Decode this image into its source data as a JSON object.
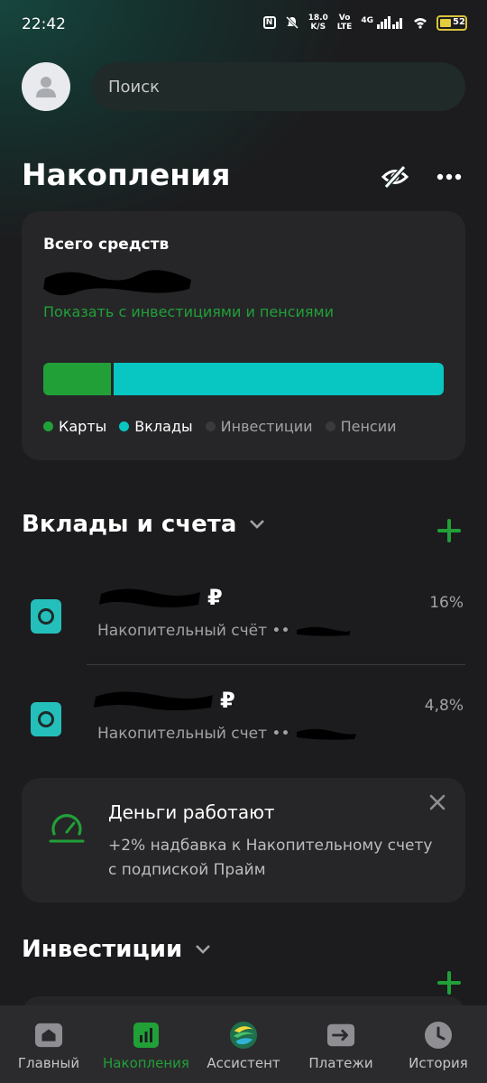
{
  "status_bar": {
    "time": "22:42",
    "speed_value": "18.0",
    "speed_unit": "K/S",
    "network_top": "Vo",
    "network_bottom": "LTE",
    "network_gen": "4G",
    "battery": "52"
  },
  "header": {
    "search_placeholder": "Поиск"
  },
  "page_title": "Накопления",
  "summary": {
    "label": "Всего средств",
    "show_link": "Показать с инвестициями и пенсиями",
    "distribution": {
      "cards": 0.17,
      "deposits": 0.83,
      "investments": 0,
      "pensions": 0
    },
    "legend": [
      {
        "label": "Карты",
        "color": "#21a038",
        "active": true
      },
      {
        "label": "Вклады",
        "color": "#08c6c2",
        "active": true
      },
      {
        "label": "Инвестиции",
        "color": "#3a3a3c",
        "active": false
      },
      {
        "label": "Пенсии",
        "color": "#3a3a3c",
        "active": false
      }
    ]
  },
  "deposits_section": {
    "title": "Вклады и счета",
    "accounts": [
      {
        "currency": "₽",
        "name": "Накопительный счёт ••",
        "rate": "16%"
      },
      {
        "currency": "₽",
        "name": "Накопительный счет ••",
        "rate": "4,8%"
      }
    ]
  },
  "promo": {
    "title": "Деньги работают",
    "text": "+2% надбавка к Накопительному счету с подпиской Прайм"
  },
  "investments_section": {
    "title": "Инвестиции"
  },
  "bottom_nav": [
    {
      "label": "Главный",
      "icon": "home-icon",
      "active": false
    },
    {
      "label": "Накопления",
      "icon": "savings-chart-icon",
      "active": true
    },
    {
      "label": "Ассистент",
      "icon": "assistant-icon",
      "active": false
    },
    {
      "label": "Платежи",
      "icon": "payments-arrow-icon",
      "active": false
    },
    {
      "label": "История",
      "icon": "history-clock-icon",
      "active": false
    }
  ],
  "colors": {
    "accent_green": "#21a038",
    "deposit_teal": "#08c6c2",
    "background": "#1c1c1e",
    "card": "#262628"
  }
}
